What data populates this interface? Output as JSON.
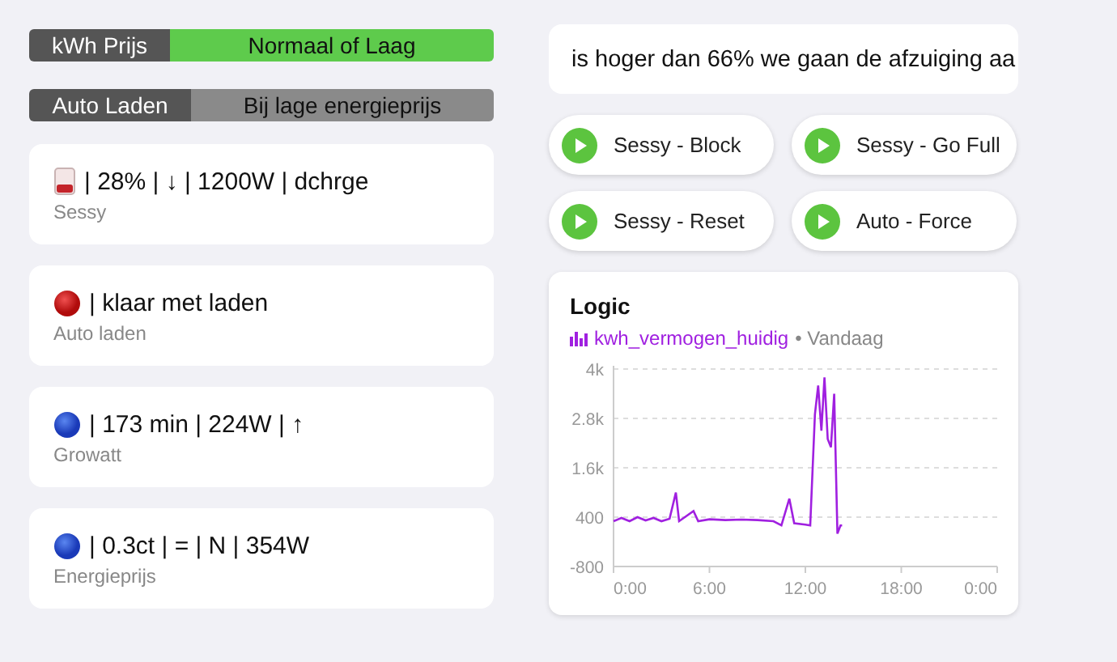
{
  "status_bars": [
    {
      "label": "kWh Prijs",
      "value": "Normaal of Laag",
      "color": "#5ecb4c"
    },
    {
      "label": "Auto Laden",
      "value": "Bij lage energieprijs",
      "color": "#8a8a8a"
    }
  ],
  "entity_cards": [
    {
      "kind": "battery",
      "state": "| 28% | ↓ | 1200W | dchrge",
      "name": "Sessy"
    },
    {
      "kind": "red-dot",
      "state": "| klaar met laden",
      "name": "Auto laden"
    },
    {
      "kind": "blue-dot",
      "state": "| 173 min | 224W | ↑",
      "name": "Growatt"
    },
    {
      "kind": "blue-dot",
      "state": "| 0.3ct | = | N | 354W",
      "name": "Energieprijs"
    }
  ],
  "marquee": {
    "text": "is hoger dan 66% we gaan de afzuiging aa"
  },
  "scripts": [
    {
      "label": "Sessy - Block"
    },
    {
      "label": "Sessy - Go Full"
    },
    {
      "label": "Sessy - Reset"
    },
    {
      "label": "Auto - Force"
    }
  ],
  "history_card": {
    "title": "Logic",
    "period": "• Vandaag",
    "chart_data": {
      "type": "line",
      "grid": true,
      "x": [
        0,
        0.5,
        1,
        1.5,
        2,
        2.5,
        3,
        3.5,
        3.9,
        4.1,
        5,
        5.3,
        6,
        7,
        8,
        9,
        10,
        10.5,
        11,
        11.3,
        12,
        12.3,
        12.6,
        12.8,
        13,
        13.2,
        13.4,
        13.6,
        13.8,
        14,
        14.2,
        14.3
      ],
      "series": [
        {
          "name": "kwh_vermogen_huidig",
          "color": "#a020e0",
          "values": [
            300,
            380,
            300,
            400,
            320,
            380,
            300,
            360,
            1000,
            300,
            550,
            300,
            350,
            330,
            340,
            330,
            300,
            200,
            850,
            250,
            220,
            200,
            2900,
            3600,
            2500,
            3800,
            2300,
            2100,
            3400,
            0,
            200,
            200
          ]
        }
      ],
      "xlim": [
        0,
        24
      ],
      "ylim": [
        -800,
        4000
      ],
      "xticks": [
        {
          "value": 0,
          "label": "0:00"
        },
        {
          "value": 6,
          "label": "6:00"
        },
        {
          "value": 12,
          "label": "12:00"
        },
        {
          "value": 18,
          "label": "18:00"
        },
        {
          "value": 24,
          "label": "0:00"
        }
      ],
      "yticks": [
        {
          "value": 4000,
          "label": "4k"
        },
        {
          "value": 2800,
          "label": "2.8k"
        },
        {
          "value": 1600,
          "label": "1.6k"
        },
        {
          "value": 400,
          "label": "400"
        },
        {
          "value": -800,
          "label": "-800"
        }
      ]
    }
  }
}
